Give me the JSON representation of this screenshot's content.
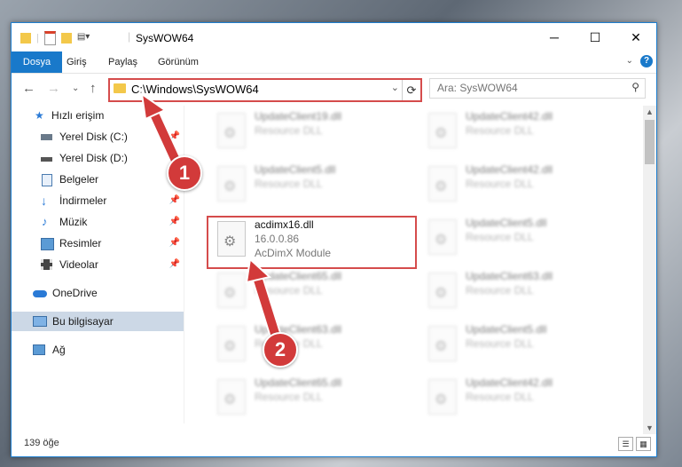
{
  "window": {
    "title": "SysWOW64",
    "controls": {
      "minimize": "─",
      "maximize": "☐",
      "close": "✕"
    }
  },
  "ribbon": {
    "tabs": [
      "Dosya",
      "Giriş",
      "Paylaş",
      "Görünüm"
    ],
    "active_tab": "Dosya",
    "expand_glyph": "⌄",
    "help_glyph": "?"
  },
  "navigation": {
    "back_glyph": "←",
    "forward_glyph": "→",
    "recent_glyph": "⌄",
    "up_glyph": "↑",
    "address": "C:\\Windows\\SysWOW64",
    "address_dropdown_glyph": "⌄",
    "refresh_glyph": "⟳",
    "search_placeholder": "Ara: SysWOW64",
    "search_glyph": "⚲"
  },
  "sidebar": {
    "items": [
      {
        "label": "Hızlı erişim",
        "icon": "star-icon",
        "pinned": false
      },
      {
        "label": "Yerel Disk (C:)",
        "icon": "drive-icon",
        "pinned": true
      },
      {
        "label": "Yerel Disk (D:)",
        "icon": "drive-icon",
        "pinned": true
      },
      {
        "label": "Belgeler",
        "icon": "documents-icon",
        "pinned": true
      },
      {
        "label": "İndirmeler",
        "icon": "download-icon",
        "pinned": true
      },
      {
        "label": "Müzik",
        "icon": "music-icon",
        "pinned": true
      },
      {
        "label": "Resimler",
        "icon": "pictures-icon",
        "pinned": true
      },
      {
        "label": "Videolar",
        "icon": "videos-icon",
        "pinned": true
      },
      {
        "label": "OneDrive",
        "icon": "cloud-icon",
        "pinned": false
      },
      {
        "label": "Bu bilgisayar",
        "icon": "computer-icon",
        "pinned": false,
        "selected": true
      },
      {
        "label": "Ağ",
        "icon": "network-icon",
        "pinned": false
      }
    ],
    "pin_glyph": "📌"
  },
  "files": {
    "left_column": [
      {
        "name": "UpdateClient19.dll",
        "type": "Resource DLL",
        "blurred": true
      },
      {
        "name": "UpdateClient5.dll",
        "type": "Resource DLL",
        "blurred": true
      },
      {
        "name": "acdimx16.dll",
        "version": "16.0.0.86",
        "description": "AcDimX Module",
        "blurred": false
      },
      {
        "name": "UpdateClient65.dll",
        "type": "Resource DLL",
        "blurred": true
      },
      {
        "name": "UpdateClient63.dll",
        "type": "Resource DLL",
        "blurred": true
      },
      {
        "name": "UpdateClient65.dll",
        "type": "Resource DLL",
        "blurred": true
      }
    ],
    "right_column": [
      {
        "name": "UpdateClient42.dll",
        "type": "Resource DLL",
        "blurred": true
      },
      {
        "name": "UpdateClient42.dll",
        "type": "Resource DLL",
        "blurred": true
      },
      {
        "name": "UpdateClient5.dll",
        "type": "Resource DLL",
        "blurred": true
      },
      {
        "name": "UpdateClient63.dll",
        "type": "Resource DLL",
        "blurred": true
      },
      {
        "name": "UpdateClient5.dll",
        "type": "Resource DLL",
        "blurred": true
      },
      {
        "name": "UpdateClient42.dll",
        "type": "Resource DLL",
        "blurred": true
      }
    ]
  },
  "status_bar": {
    "item_count": "139 öğe",
    "view_glyphs": [
      "☰",
      "▦"
    ]
  },
  "annotations": {
    "badges": [
      "1",
      "2"
    ],
    "accent_color": "#d23a3a"
  },
  "theme": {
    "accent": "#1979ca",
    "highlight": "#d54c4c",
    "selected_bg": "#ccd8e6"
  }
}
